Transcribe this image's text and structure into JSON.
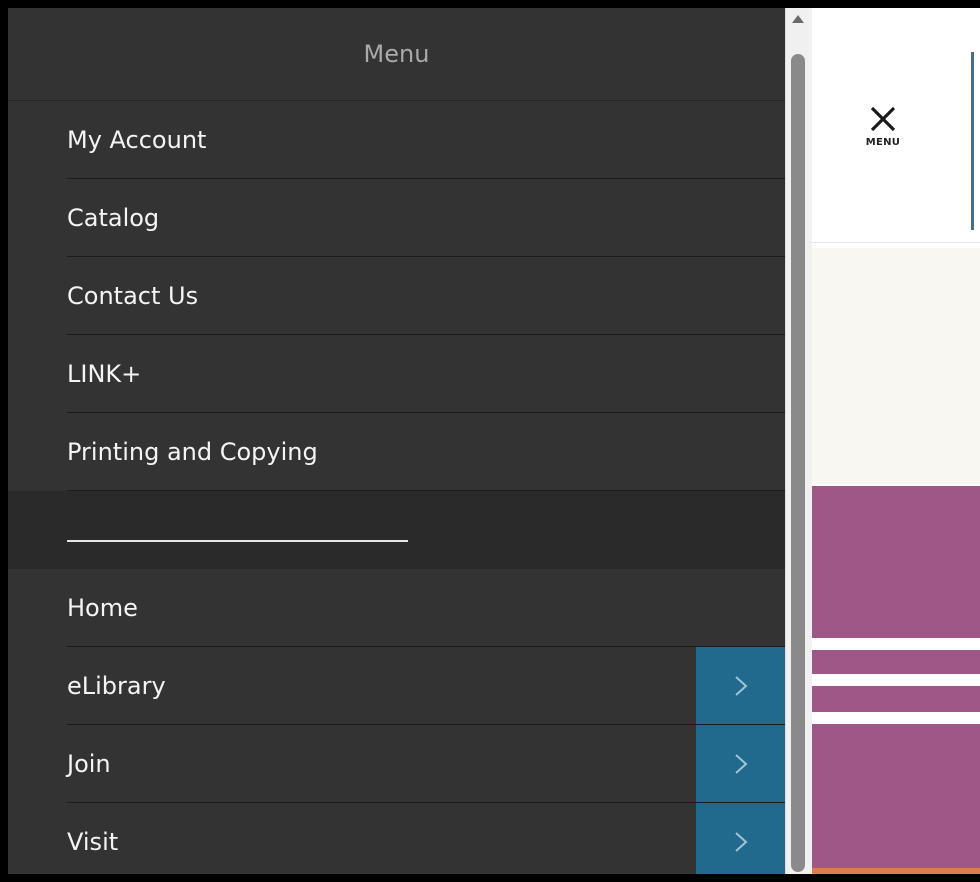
{
  "menu": {
    "title": "Menu",
    "items": [
      {
        "label": "My Account"
      },
      {
        "label": "Catalog"
      },
      {
        "label": "Contact Us"
      },
      {
        "label": "LINK+"
      },
      {
        "label": "Printing and Copying"
      },
      {
        "label": "Home"
      },
      {
        "label": "eLibrary",
        "submenu_icon": "chevron-right-icon"
      },
      {
        "label": "Join",
        "submenu_icon": "chevron-right-icon"
      },
      {
        "label": "Visit",
        "submenu_icon": "chevron-right-icon"
      }
    ]
  },
  "header": {
    "close_label": "MENU",
    "close_icon": "close-icon"
  },
  "colors": {
    "menu_background": "#333333",
    "submenu_button": "#216a8e",
    "purple_banner": "#9e5888",
    "cream_band": "#f8f7f1"
  }
}
